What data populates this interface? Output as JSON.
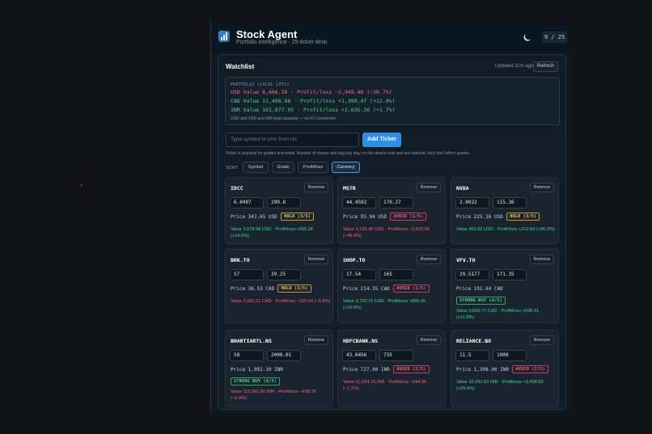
{
  "app": {
    "title": "Stock Agent",
    "subtitle": "Portfolio intelligence · 25-ticker desk",
    "counter": "9 / 25"
  },
  "watchlist": {
    "title": "Watchlist",
    "updated": "Updated 11m ago",
    "refresh_label": "Refresh"
  },
  "portfolio": {
    "heading": "PORTFOLIO (LOCAL LOTS)",
    "usd": "USD Value 6,666.28 · Profit/loss −2,948.46 (−30.7%)",
    "cad": "CAD Value 11,498.68 · Profit/loss +1,309.47 (+12.9%)",
    "inr": "INR Value 161,877.95 · Profit/loss +2,635.36 (+1.7%)",
    "note": "USD and CAD and INR kept separate — no FX conversion."
  },
  "add": {
    "placeholder": "Type symbol or pick from list",
    "button_label": "Add Ticker",
    "hint": "Ticker is required for grades and email. Number of shares and avg buy stay on this device only and are optional; they don't affect grades."
  },
  "sort": {
    "label": "SORT",
    "options": [
      "Symbol",
      "Grade",
      "Profit/loss",
      "Currency"
    ],
    "active": "Currency"
  },
  "cards": [
    {
      "ticker": "IDCC",
      "shares": "6.0497",
      "avg": "299.8",
      "price": "Price 343.65 USD",
      "grade": "HOLD (3/5)",
      "tone": "hold",
      "value": "Value 2,078.98 USD · Profit/loss +265.28 (+14.6%)",
      "pl": "pos"
    },
    {
      "ticker": "MSTR",
      "shares": "44.4592",
      "avg": "170.27",
      "price": "Price 93.04 USD",
      "grade": "AVOID (1/5)",
      "tone": "avoid",
      "value": "Value 4,136.48 USD · Profit/loss −3,433.58 (−45.4%)",
      "pl": "neg"
    },
    {
      "ticker": "NVDA",
      "shares": "2.0022",
      "avg": "115.36",
      "price": "Price 225.16 USD",
      "grade": "HOLD (3/5)",
      "tone": "hold",
      "value": "Value 450.82 USD · Profit/loss +219.84 (+95.2%)",
      "pl": "pos"
    },
    {
      "ticker": "BRK.TO",
      "shares": "57",
      "avg": "39.25",
      "price": "Price 36.53 CAD",
      "grade": "HOLD (3/5)",
      "tone": "hold",
      "value": "Value 2,082.21 CAD · Profit/loss −155.04 (−6.9%)",
      "pl": "neg"
    },
    {
      "ticker": "SHOP.TO",
      "shares": "17.54",
      "avg": "165",
      "price": "Price 214.35 CAD",
      "grade": "AVOID (1/5)",
      "tone": "avoid",
      "value": "Value 3,759.70 CAD · Profit/loss +865.60 (+29.9%)",
      "pl": "pos"
    },
    {
      "ticker": "VFV.TO",
      "shares": "29.5177",
      "avg": "171.35",
      "price": "Price 191.64 CAD",
      "grade": "STRONG BUY (4/5)",
      "tone": "buy",
      "value": "Value 5,656.77 CAD · Profit/loss +598.91 (+11.8%)",
      "pl": "pos"
    },
    {
      "ticker": "BHARTIARTL.NS",
      "shares": "58",
      "avg": "2000.01",
      "price": "Price 1,992.10 INR",
      "grade": "STRONG BUY (4/5)",
      "tone": "buy",
      "value": "Value 115,541.80 INR · Profit/loss −458.78 (−0.4%)",
      "pl": "neg"
    },
    {
      "ticker": "HDFCBANK.NS",
      "shares": "43.0456",
      "avg": "735",
      "price": "Price 727.00 INR",
      "grade": "AVOID (2/5)",
      "tone": "avoid",
      "value": "Value 31,294.15 INR · Profit/loss −344.36 (−1.1%)",
      "pl": "neg"
    },
    {
      "ticker": "RELIANCE.BO",
      "shares": "11.5",
      "avg": "1009",
      "price": "Price 1,308.00 INR",
      "grade": "AVOID (2/5)",
      "tone": "avoid",
      "value": "Value 15,042.00 INR · Profit/loss +3,438.50 (+29.6%)",
      "pl": "pos"
    }
  ],
  "card_remove_label": "Remove"
}
